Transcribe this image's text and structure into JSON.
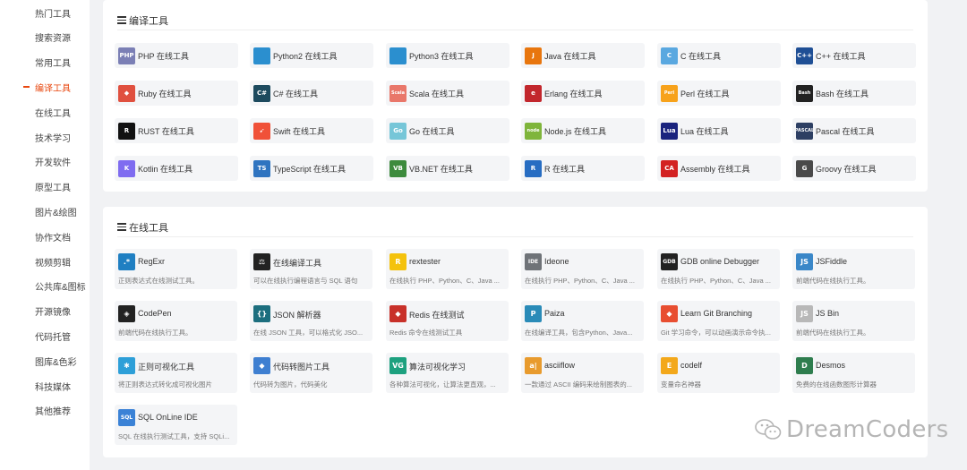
{
  "sidebar": {
    "items": [
      {
        "label": "热门工具"
      },
      {
        "label": "搜索资源"
      },
      {
        "label": "常用工具"
      },
      {
        "label": "编译工具",
        "active": true
      },
      {
        "label": "在线工具"
      },
      {
        "label": "技术学习"
      },
      {
        "label": "开发软件"
      },
      {
        "label": "原型工具"
      },
      {
        "label": "图片&绘图"
      },
      {
        "label": "协作文档"
      },
      {
        "label": "视频剪辑"
      },
      {
        "label": "公共库&图标"
      },
      {
        "label": "开源镜像"
      },
      {
        "label": "代码托管"
      },
      {
        "label": "图库&色彩"
      },
      {
        "label": "科技媒体"
      },
      {
        "label": "其他推荐"
      }
    ]
  },
  "compile_section": {
    "title": "编译工具",
    "tools": [
      {
        "label": "PHP 在线工具",
        "icon": "php-icon",
        "icon_text": "PHP",
        "color": "#7b7fb5"
      },
      {
        "label": "Python2 在线工具",
        "icon": "python-icon",
        "icon_text": "",
        "color": "#2b8fcf"
      },
      {
        "label": "Python3 在线工具",
        "icon": "python-icon",
        "icon_text": "",
        "color": "#2b8fcf"
      },
      {
        "label": "Java 在线工具",
        "icon": "java-icon",
        "icon_text": "J",
        "color": "#e8760e"
      },
      {
        "label": "C 在线工具",
        "icon": "c-icon",
        "icon_text": "C",
        "color": "#5aa8e0"
      },
      {
        "label": "C++ 在线工具",
        "icon": "cpp-icon",
        "icon_text": "C++",
        "color": "#1f4f95"
      },
      {
        "label": "Ruby 在线工具",
        "icon": "ruby-icon",
        "icon_text": "◆",
        "color": "#e0503f"
      },
      {
        "label": "C# 在线工具",
        "icon": "csharp-icon",
        "icon_text": "C#",
        "color": "#1d4a5e"
      },
      {
        "label": "Scala 在线工具",
        "icon": "scala-icon",
        "icon_text": "Scala",
        "color": "#e9776a"
      },
      {
        "label": "Erlang 在线工具",
        "icon": "erlang-icon",
        "icon_text": "e",
        "color": "#c2272d"
      },
      {
        "label": "Perl 在线工具",
        "icon": "perl-icon",
        "icon_text": "Perl",
        "color": "#f7a21b"
      },
      {
        "label": "Bash 在线工具",
        "icon": "bash-icon",
        "icon_text": "Bash",
        "color": "#222222"
      },
      {
        "label": "RUST 在线工具",
        "icon": "rust-icon",
        "icon_text": "R",
        "color": "#111111"
      },
      {
        "label": "Swift 在线工具",
        "icon": "swift-icon",
        "icon_text": "➹",
        "color": "#f05138"
      },
      {
        "label": "Go 在线工具",
        "icon": "go-icon",
        "icon_text": "Go",
        "color": "#76c6d8"
      },
      {
        "label": "Node.js 在线工具",
        "icon": "nodejs-icon",
        "icon_text": "node",
        "color": "#7fb53b"
      },
      {
        "label": "Lua 在线工具",
        "icon": "lua-icon",
        "icon_text": "Lua",
        "color": "#1a237e"
      },
      {
        "label": "Pascal 在线工具",
        "icon": "pascal-icon",
        "icon_text": "PASCAL",
        "color": "#2d3f63"
      },
      {
        "label": "Kotlin 在线工具",
        "icon": "kotlin-icon",
        "icon_text": "K",
        "color": "#7f6cf0"
      },
      {
        "label": "TypeScript 在线工具",
        "icon": "typescript-icon",
        "icon_text": "TS",
        "color": "#2f74c0"
      },
      {
        "label": "VB.NET 在线工具",
        "icon": "vbnet-icon",
        "icon_text": "VB",
        "color": "#3d8b3d"
      },
      {
        "label": "R 在线工具",
        "icon": "r-icon",
        "icon_text": "R",
        "color": "#276dc2"
      },
      {
        "label": "Assembly 在线工具",
        "icon": "assembly-icon",
        "icon_text": "CA",
        "color": "#d32222"
      },
      {
        "label": "Groovy 在线工具",
        "icon": "groovy-icon",
        "icon_text": "G",
        "color": "#4a4a4a"
      }
    ]
  },
  "online_section": {
    "title": "在线工具",
    "tools": [
      {
        "title": "RegExr",
        "desc": "正则表达式在线测试工具。",
        "icon": "regexr-icon",
        "icon_text": ".*",
        "color": "#1f7fc2"
      },
      {
        "title": "在线编译工具",
        "desc": "可以在线执行编程语言与 SQL 语句",
        "icon": "gavel-icon",
        "icon_text": "⚖",
        "color": "#222222"
      },
      {
        "title": "rextester",
        "desc": "在线执行 PHP、Python、C、Java ...",
        "icon": "rextester-icon",
        "icon_text": "R",
        "color": "#f4c20d"
      },
      {
        "title": "Ideone",
        "desc": "在线执行 PHP、Python、C、Java ...",
        "icon": "ideone-icon",
        "icon_text": "IDE",
        "color": "#6f7378"
      },
      {
        "title": "GDB online Debugger",
        "desc": "在线执行 PHP、Python、C、Java ...",
        "icon": "gdb-icon",
        "icon_text": "GDB",
        "color": "#222222"
      },
      {
        "title": "JSFiddle",
        "desc": "前端代码在线执行工具。",
        "icon": "jsfiddle-icon",
        "icon_text": "JS",
        "color": "#3a87c8"
      },
      {
        "title": "CodePen",
        "desc": "前端代码在线执行工具。",
        "icon": "codepen-icon",
        "icon_text": "◈",
        "color": "#222222"
      },
      {
        "title": "JSON 解析器",
        "desc": "在线 JSON 工具，可以格式化 JSO...",
        "icon": "json-icon",
        "icon_text": "{}",
        "color": "#1c6e7e"
      },
      {
        "title": "Redis 在线测试",
        "desc": "Redis 命令在线测试工具",
        "icon": "redis-icon",
        "icon_text": "◆",
        "color": "#c8312a"
      },
      {
        "title": "Paiza",
        "desc": "在线编译工具，包含Python、Java...",
        "icon": "paiza-icon",
        "icon_text": "P",
        "color": "#2a8bb8"
      },
      {
        "title": "Learn Git Branching",
        "desc": "Git 学习命令，可以动画演示命令执...",
        "icon": "git-icon",
        "icon_text": "◆",
        "color": "#e84e31"
      },
      {
        "title": "JS Bin",
        "desc": "前端代码在线执行工具。",
        "icon": "jsbin-icon",
        "icon_text": "JS",
        "color": "#b8b8b8"
      },
      {
        "title": "正则可视化工具",
        "desc": "将正则表达式转化成可视化图片",
        "icon": "regex-visual-icon",
        "icon_text": "✱",
        "color": "#2d9fd8"
      },
      {
        "title": "代码转图片工具",
        "desc": "代码转为图片，代码美化",
        "icon": "code-image-icon",
        "icon_text": "◆",
        "color": "#3e7fd1"
      },
      {
        "title": "算法可视化学习",
        "desc": "各种算法可视化，让算法更直观，...",
        "icon": "visualgo-icon",
        "icon_text": "VG",
        "color": "#1da17f"
      },
      {
        "title": "asciiflow",
        "desc": "一款通过 ASCII 编码来绘制图表的...",
        "icon": "asciiflow-icon",
        "icon_text": "a|",
        "color": "#e89b2e"
      },
      {
        "title": "codelf",
        "desc": "变量命名神器",
        "icon": "codelf-icon",
        "icon_text": "E",
        "color": "#f3a81b"
      },
      {
        "title": "Desmos",
        "desc": "免费的在线函数图形计算器",
        "icon": "desmos-icon",
        "icon_text": "D",
        "color": "#2e7d4e"
      },
      {
        "title": "SQL OnLine IDE",
        "desc": "SQL 在线执行测试工具，支持 SQLi...",
        "icon": "sql-icon",
        "icon_text": "SQL",
        "color": "#3b82d6"
      }
    ]
  },
  "watermark": {
    "text": "DreamCoders"
  }
}
